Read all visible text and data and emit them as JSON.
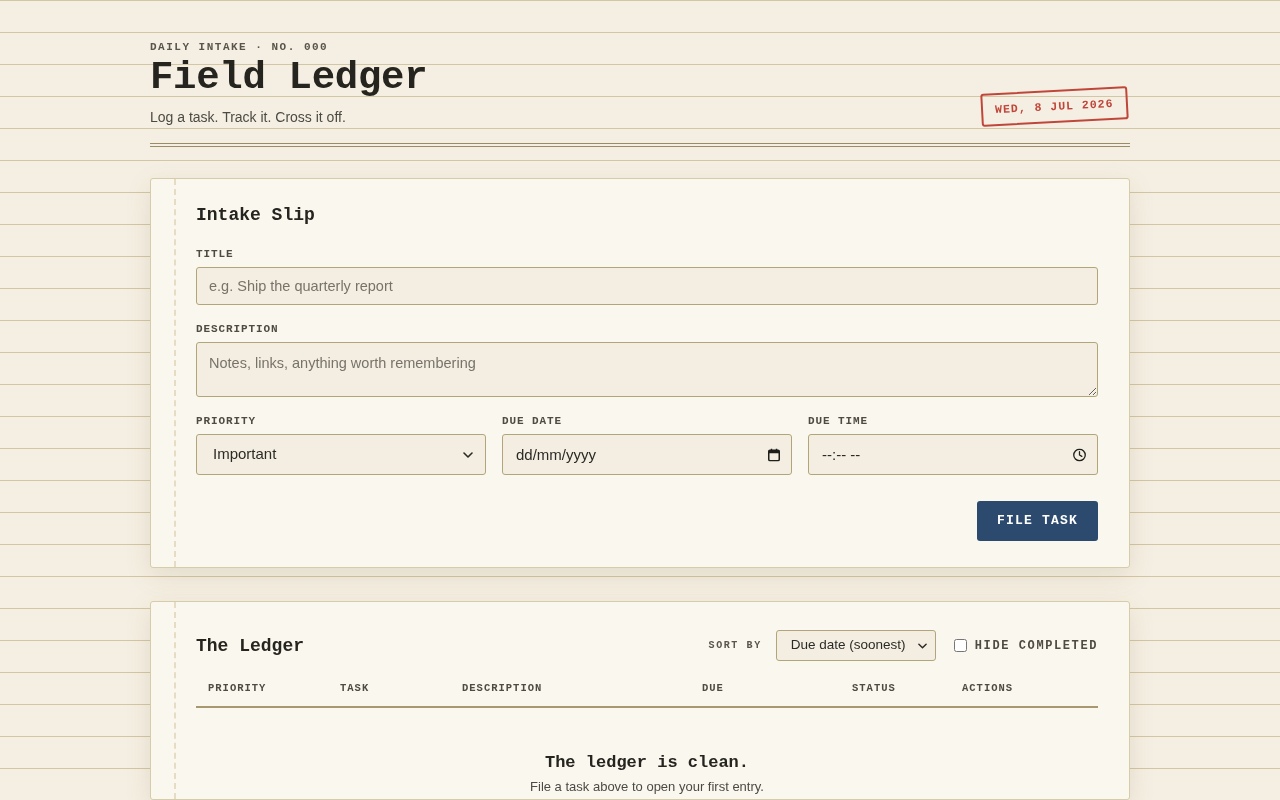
{
  "header": {
    "eyebrow": "DAILY INTAKE · NO. 000",
    "title": "Field Ledger",
    "tagline": "Log a task. Track it. Cross it off.",
    "date_stamp": "WED, 8 JUL 2026"
  },
  "intake_form": {
    "heading": "Intake Slip",
    "fields": [
      {
        "kind": "text",
        "label": "TITLE",
        "placeholder": "e.g. Ship the quarterly report"
      },
      {
        "kind": "textarea",
        "label": "DESCRIPTION",
        "placeholder": "Notes, links, anything worth remembering"
      },
      {
        "kind": "select",
        "label": "PRIORITY",
        "value": "Important"
      },
      {
        "kind": "date",
        "label": "DUE DATE",
        "placeholder": "dd/mm/yyyy"
      },
      {
        "kind": "time",
        "label": "DUE TIME",
        "placeholder": "--:-- --"
      }
    ],
    "submit_button": "FILE TASK"
  },
  "ledger": {
    "heading": "The Ledger",
    "sort": {
      "label": "SORT BY",
      "value": "Due date (soonest)"
    },
    "hide_completed": {
      "label": "HIDE COMPLETED",
      "checked": false
    },
    "table": {
      "columns": [
        "PRIORITY",
        "TASK",
        "DESCRIPTION",
        "DUE",
        "STATUS",
        "ACTIONS"
      ]
    },
    "empty_state": {
      "title": "The ledger is clean.",
      "message": "File a task above to open your first entry."
    }
  }
}
